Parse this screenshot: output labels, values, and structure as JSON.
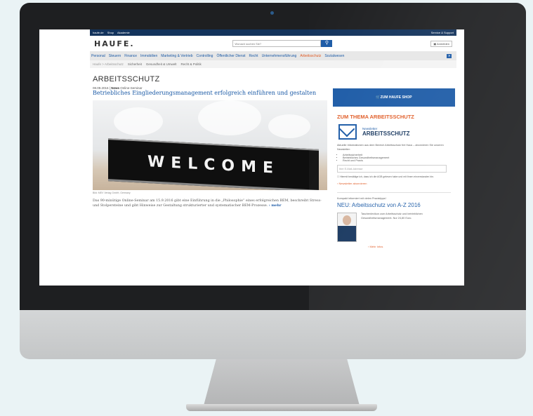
{
  "site": {
    "topbar_links": [
      "haufe.de",
      "Shop",
      "Akademie"
    ],
    "topbar_right": "Service & Support",
    "logo": "HAUFE.",
    "search_placeholder": "Wonach suchen Sie?",
    "login_label": "Anmelden",
    "nav": [
      "Personal",
      "Steuern",
      "Finance",
      "Immobilien",
      "Marketing & Vertrieb",
      "Controlling",
      "Öffentlicher Dienst",
      "Recht",
      "Unternehmensführung",
      "Arbeitsschutz",
      "Sozialwesen"
    ],
    "nav_active_index": 9,
    "subnav_crumb": "Haufe > Arbeitsschutz",
    "subnav": [
      "Sicherheit",
      "Gesundheit & Umwelt",
      "Recht & Politik"
    ]
  },
  "article": {
    "section_title": "ARBEITSSCHUTZ",
    "date": "08.09.2016",
    "type": "News",
    "category": "Online-Seminar",
    "headline": "Betriebliches Eingliederungsmanagement erfolgreich einführen und gestalten",
    "image_text": "WELCOME",
    "image_caption": "Bild: MEV Verlag GmbH, Germany",
    "teaser": "Das 90-minütige Online-Seminar am 15.9.2016 gibt eine Einführung in die „Philosophie“ eines erfolgreichen BEM, beschreibt Stress- und Stolpersteine und gibt Hinweise zur Gestaltung strukturierter und systematischer BEM-Prozesse.",
    "more_label": "mehr"
  },
  "sidebar": {
    "shop_button": "ZUM HAUFE SHOP",
    "title": "ZUM THEMA ARBEITSSCHUTZ",
    "nl_small": "Newsletter",
    "nl_big": "ARBEITSSCHUTZ",
    "nl_desc": "Aktuelle Informationen aus dem Bereich Arbeitsschutz frei Haus – abonnieren Sie unseren Newsletter:",
    "nl_items": [
      "Arbeitssicherheit",
      "Betriebliches Gesundheitsmanagement",
      "Recht und Praxis"
    ],
    "email_placeholder": "Ihre E-Mail-Adresse",
    "consent": "Hiermit bestätige ich, dass ich die AGB gelesen habe und mit ihnen einverstanden bin.",
    "abo_label": "Newsletter abonnieren",
    "kompakt": "Kompakt informiert mit vielen Praxistipps!",
    "neu_title": "NEU: Arbeitsschutz von A-Z 2016",
    "prod_desc": "Taschenlexikon zum Arbeitsschutz und betrieblichen Gesundheitsmanagement. Nur 24,80 Euro.",
    "prod_more": "Mehr Infos"
  },
  "colors": {
    "accent_blue": "#1b5aa6",
    "accent_orange": "#e05a24",
    "dark_blue": "#13335c"
  }
}
